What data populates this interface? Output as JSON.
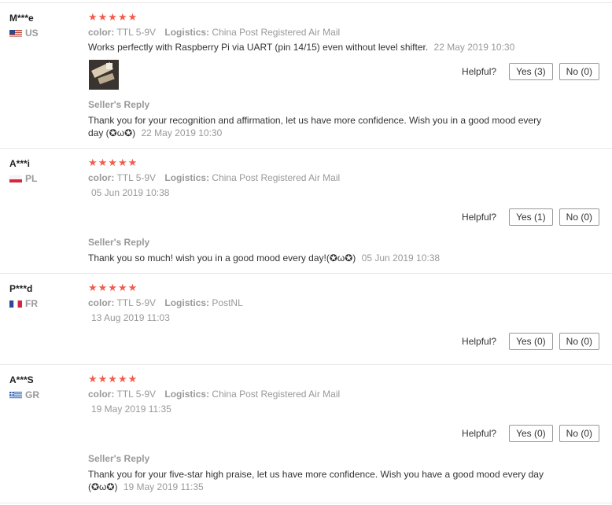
{
  "helpful_label": "Helpful?",
  "stars": "★★★★★",
  "color_key": "color:",
  "logistics_key": "Logistics:",
  "reply_title": "Seller's Reply",
  "reviews": [
    {
      "user": "M***e",
      "country": "US",
      "flag": "us-flag-icon",
      "color": "TTL 5-9V",
      "logistics": "China Post Registered Air Mail",
      "text": "Works perfectly with Raspberry Pi via UART (pin 14/15) even without level shifter.",
      "date": "22 May 2019 10:30",
      "yes": "Yes (3)",
      "no": "No (0)",
      "reply": "Thank you for your recognition and affirmation, let us have more confidence. Wish you in a good mood every day (✪ω✪)",
      "reply_date": "22 May 2019 10:30"
    },
    {
      "user": "A***i",
      "country": "PL",
      "flag": "pl-flag-icon",
      "color": "TTL 5-9V",
      "logistics": "China Post Registered Air Mail",
      "text": "",
      "date": "05 Jun 2019 10:38",
      "yes": "Yes (1)",
      "no": "No (0)",
      "reply": "Thank you so much! wish you in a good mood every day!(✪ω✪)",
      "reply_date": "05 Jun 2019 10:38"
    },
    {
      "user": "P***d",
      "country": "FR",
      "flag": "fr-flag-icon",
      "color": "TTL 5-9V",
      "logistics": "PostNL",
      "text": "",
      "date": "13 Aug 2019 11:03",
      "yes": "Yes (0)",
      "no": "No (0)"
    },
    {
      "user": "A***S",
      "country": "GR",
      "flag": "gr-flag-icon",
      "color": "TTL 5-9V",
      "logistics": "China Post Registered Air Mail",
      "text": "",
      "date": "19 May 2019 11:35",
      "yes": "Yes (0)",
      "no": "No (0)",
      "reply": "Thank you for your five-star high praise, let us have more confidence. Wish you have a good mood every day (✪ω✪)",
      "reply_date": "19 May 2019 11:35"
    }
  ]
}
